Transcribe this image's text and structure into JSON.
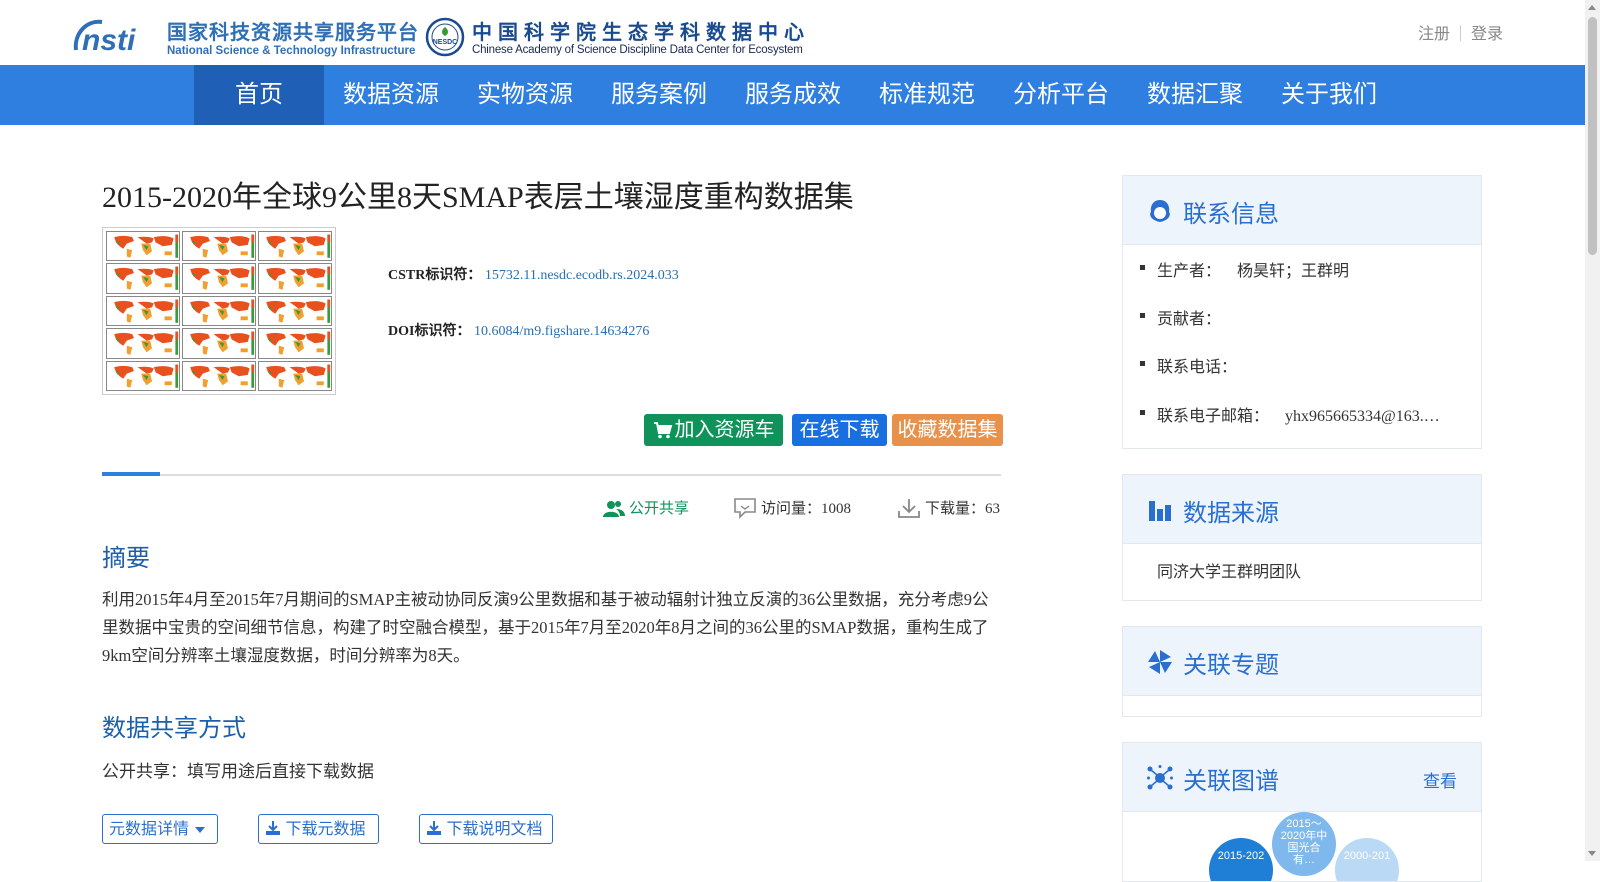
{
  "header": {
    "logo1_cn": "国家科技资源共享服务平台",
    "logo1_en": "National Science & Technology Infrastructure",
    "logo1_mark": "nsti",
    "logo2_badge": "NESDC",
    "logo2_cn": "中国科学院生态学科数据中心",
    "logo2_en": "Chinese Academy of Science Discipline Data Center for Ecosystem",
    "register": "注册",
    "login": "登录"
  },
  "nav": {
    "items": [
      "首页",
      "数据资源",
      "实物资源",
      "服务案例",
      "服务成效",
      "标准规范",
      "分析平台",
      "数据汇聚",
      "关于我们"
    ],
    "active_index": 0
  },
  "dataset": {
    "title": "2015-2020年全球9公里8天SMAP表层土壤湿度重构数据集",
    "cstr_label": "CSTR标识符：",
    "cstr_value": "15732.11.nesdc.ecodb.rs.2024.033",
    "doi_label": "DOI标识符：",
    "doi_value": "10.6084/m9.figshare.14634276"
  },
  "actions": {
    "add_cart": "加入资源车",
    "download": "在线下载",
    "favorite": "收藏数据集"
  },
  "stats": {
    "share": "公开共享",
    "visits": "访问量：1008",
    "downloads": "下载量：63"
  },
  "abstract": {
    "heading": "摘要",
    "text": "利用2015年4月至2015年7月期间的SMAP主被动协同反演9公里数据和基于被动辐射计独立反演的36公里数据，充分考虑9公里数据中宝贵的空间细节信息，构建了时空融合模型，基于2015年7月至2020年8月之间的36公里的SMAP数据，重构生成了9km空间分辨率土壤湿度数据，时间分辨率为8天。"
  },
  "sharing": {
    "heading": "数据共享方式",
    "text": "公开共享：填写用途后直接下载数据"
  },
  "doc_buttons": {
    "metadata": "元数据详情",
    "download_meta": "下载元数据",
    "download_doc": "下载说明文档"
  },
  "sidebar": {
    "contact": {
      "title": "联系信息",
      "producer_label": "生产者：",
      "producer_value": "杨昊轩；王群明",
      "contributor_label": "贡献者：",
      "phone_label": "联系电话：",
      "email_label": "联系电子邮箱：",
      "email_value": "yhx965665334@163.…"
    },
    "source": {
      "title": "数据来源",
      "text": "同济大学王群明团队"
    },
    "topic": {
      "title": "关联专题"
    },
    "graph": {
      "title": "关联图谱",
      "more": "查看",
      "nodes": [
        "2015-202",
        "2015～2020年中国光合有…",
        "2000-201"
      ]
    }
  },
  "colors": {
    "nav_bg": "#2f7fe0",
    "nav_active": "#1f5fb5",
    "btn_cart": "#10935a",
    "btn_download": "#1a6fe0",
    "btn_favorite": "#e8914a",
    "heading_blue": "#1d5fa8"
  },
  "icons": {
    "cart": "cart-icon",
    "share": "users-icon",
    "visits": "comment-icon",
    "downloads": "download-icon",
    "contact": "person-icon",
    "source": "bar-chart-icon",
    "topic": "pinwheel-icon",
    "graph": "network-icon"
  }
}
